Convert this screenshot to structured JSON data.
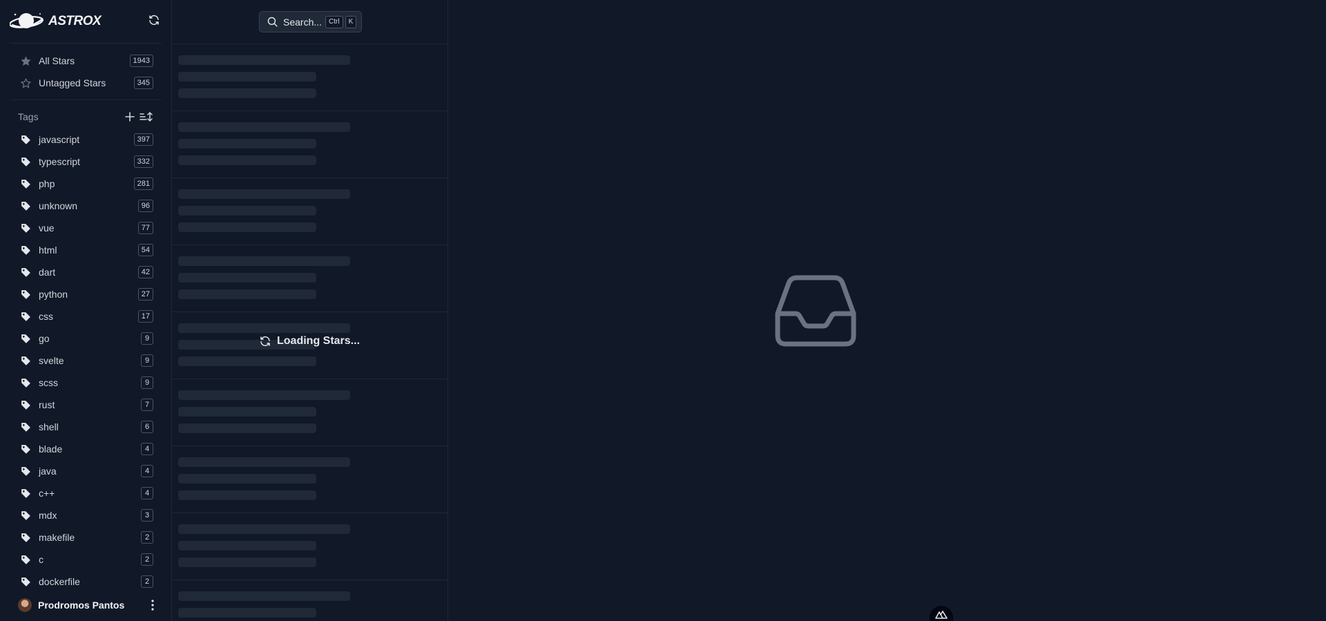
{
  "app": {
    "brand": "ASTROX"
  },
  "sidebar": {
    "nav": [
      {
        "label": "All Stars",
        "count": "1943",
        "icon": "star-solid-icon"
      },
      {
        "label": "Untagged Stars",
        "count": "345",
        "icon": "star-outline-icon"
      }
    ],
    "tags_title": "Tags",
    "tags": [
      {
        "label": "javascript",
        "count": "397"
      },
      {
        "label": "typescript",
        "count": "332"
      },
      {
        "label": "php",
        "count": "281"
      },
      {
        "label": "unknown",
        "count": "96"
      },
      {
        "label": "vue",
        "count": "77"
      },
      {
        "label": "html",
        "count": "54"
      },
      {
        "label": "dart",
        "count": "42"
      },
      {
        "label": "python",
        "count": "27"
      },
      {
        "label": "css",
        "count": "17"
      },
      {
        "label": "go",
        "count": "9"
      },
      {
        "label": "svelte",
        "count": "9"
      },
      {
        "label": "scss",
        "count": "9"
      },
      {
        "label": "rust",
        "count": "7"
      },
      {
        "label": "shell",
        "count": "6"
      },
      {
        "label": "blade",
        "count": "4"
      },
      {
        "label": "java",
        "count": "4"
      },
      {
        "label": "c++",
        "count": "4"
      },
      {
        "label": "mdx",
        "count": "3"
      },
      {
        "label": "makefile",
        "count": "2"
      },
      {
        "label": "c",
        "count": "2"
      },
      {
        "label": "dockerfile",
        "count": "2"
      }
    ],
    "user": {
      "name": "Prodromos Pantos"
    }
  },
  "search": {
    "label": "Search...",
    "shortcut": [
      "Ctrl",
      "K"
    ]
  },
  "list": {
    "loading_text": "Loading Stars...",
    "skeleton_rows": 9
  },
  "colors": {
    "background": "#111827",
    "surface": "#1f2937",
    "border": "#374151",
    "text": "#d1d5db",
    "muted_icon": "#6b7280"
  }
}
